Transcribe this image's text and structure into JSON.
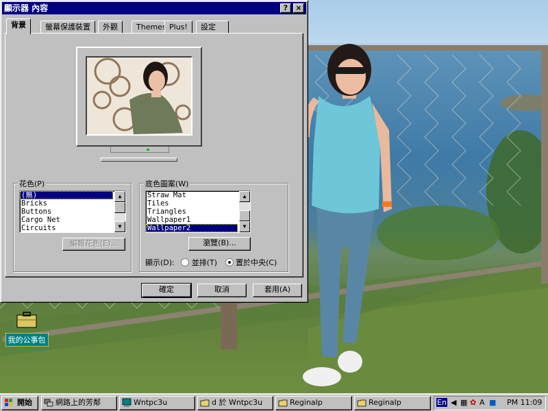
{
  "dialog": {
    "title": "顯示器 內容",
    "help_button": "?",
    "close_button": "×",
    "tabs": [
      "背景",
      "螢幕保護裝置",
      "外觀",
      "Themes",
      "Plus!",
      "設定"
    ],
    "pattern": {
      "label": "花色(P)",
      "items": [
        "(無)",
        "Bricks",
        "Buttons",
        "Cargo Net",
        "Circuits"
      ],
      "selected_index": 0,
      "edit_button": "編輯花色(E)..."
    },
    "wallpaper": {
      "label": "底色圖案(W)",
      "items": [
        "Straw Mat",
        "Tiles",
        "Triangles",
        "Wallpaper1",
        "Wallpaper2"
      ],
      "selected_index": 4,
      "browse_button": "瀏覽(B)...",
      "display_label": "顯示(D):",
      "options": [
        "並排(T)",
        "置於中央(C)"
      ],
      "selected_option": "置於中央(C)"
    },
    "buttons": {
      "ok": "確定",
      "cancel": "取消",
      "apply": "套用(A)"
    }
  },
  "desktop": {
    "icon_label": "我的公事包"
  },
  "taskbar": {
    "start_label": "開始",
    "items": [
      {
        "label": "網路上的芳鄰",
        "icon": "network-icon"
      },
      {
        "label": "Wntpc3u",
        "icon": "computer-icon"
      },
      {
        "label": "d 於 Wntpc3u",
        "icon": "folder-icon"
      },
      {
        "label": "ReginaIp",
        "icon": "folder-icon"
      },
      {
        "label": "ReginaIp",
        "icon": "folder-icon"
      }
    ],
    "tray": {
      "lang": "En",
      "clock": "PM 11:09"
    }
  },
  "colors": {
    "titlebar": "#000080",
    "face": "#c0c0c0",
    "desktop_teal": "#008080",
    "selection": "#000080"
  }
}
